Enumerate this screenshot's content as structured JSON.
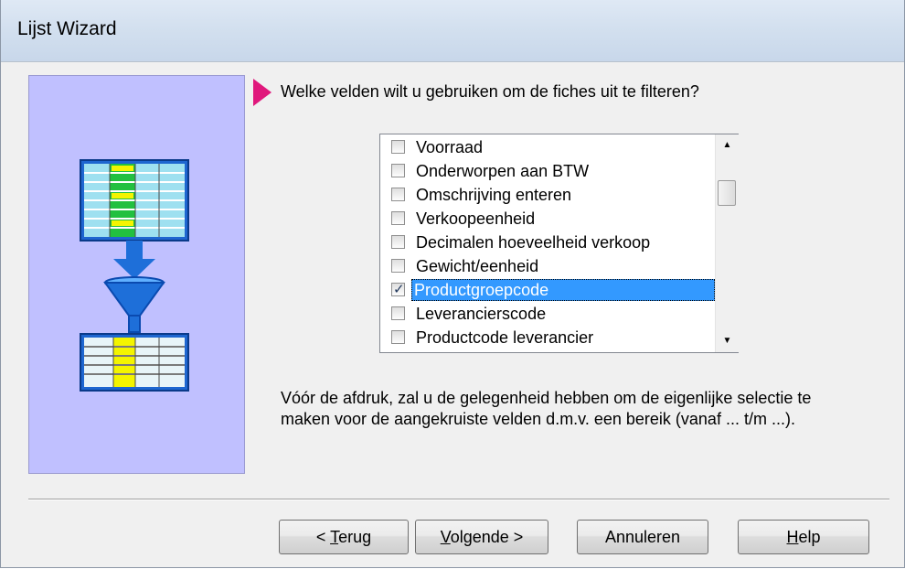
{
  "window": {
    "title": "Lijst Wizard"
  },
  "prompt": "Welke velden wilt u gebruiken om de fiches uit te filteren?",
  "field_list": {
    "items": [
      {
        "label": "Voorraad",
        "checked": false,
        "selected": false
      },
      {
        "label": "Onderworpen aan BTW",
        "checked": false,
        "selected": false
      },
      {
        "label": "Omschrijving enteren",
        "checked": false,
        "selected": false
      },
      {
        "label": "Verkoopeenheid",
        "checked": false,
        "selected": false
      },
      {
        "label": "Decimalen hoeveelheid verkoop",
        "checked": false,
        "selected": false
      },
      {
        "label": "Gewicht/eenheid",
        "checked": false,
        "selected": false
      },
      {
        "label": "Productgroepcode",
        "checked": true,
        "selected": true
      },
      {
        "label": "Leverancierscode",
        "checked": false,
        "selected": false
      },
      {
        "label": "Productcode leverancier",
        "checked": false,
        "selected": false
      }
    ],
    "scroll_up_glyph": "▲",
    "scroll_down_glyph": "▼",
    "check_glyph": "✓"
  },
  "info_text": "Vóór de afdruk, zal u de gelegenheid hebben om de eigenlijke selectie te maken voor de aangekruiste velden d.m.v. een bereik  (vanaf ... t/m ...).",
  "buttons": {
    "back": {
      "prefix": "< ",
      "accel": "T",
      "rest": "erug"
    },
    "next": {
      "prefix": "",
      "accel": "V",
      "rest": "olgende >"
    },
    "cancel": {
      "label": "Annuleren"
    },
    "help": {
      "prefix": "",
      "accel": "H",
      "rest": "elp"
    }
  },
  "colors": {
    "side_panel_bg": "#c0c0ff",
    "accent_arrow": "#e0187c",
    "selection": "#3399ff",
    "filter_blue": "#1e6fd9"
  },
  "icons": [
    "arrow-marker-icon",
    "table-icon",
    "down-arrow-icon",
    "funnel-icon",
    "filtered-table-icon"
  ]
}
